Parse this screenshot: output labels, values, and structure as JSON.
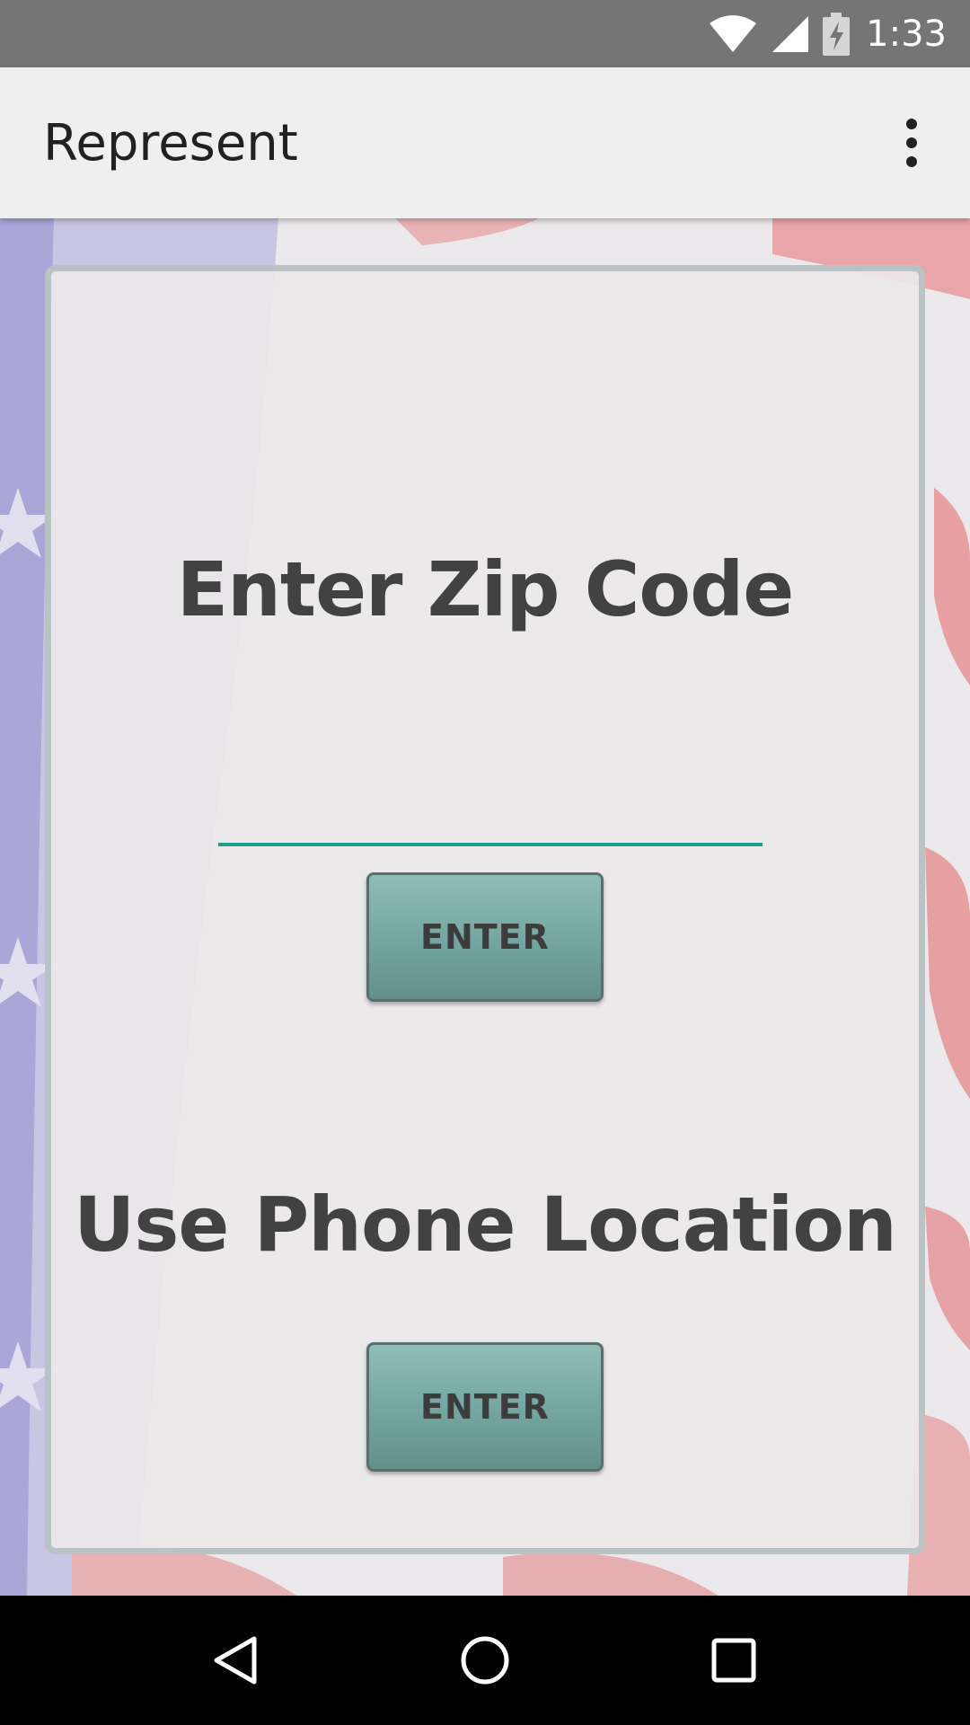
{
  "status_bar": {
    "time": "1:33",
    "icons": [
      "wifi-icon",
      "signal-icon",
      "battery-charging-icon"
    ]
  },
  "app_bar": {
    "title": "Represent",
    "overflow_icon": "more-vert-icon"
  },
  "zip_section": {
    "heading": "Enter Zip Code",
    "input_value": "",
    "button_label": "ENTER"
  },
  "location_section": {
    "heading": "Use Phone Location",
    "button_label": "ENTER"
  },
  "nav_bar": {
    "icons": [
      "back-icon",
      "home-icon",
      "recents-icon"
    ]
  },
  "colors": {
    "status_bar": "#757575",
    "app_bar": "#efefef",
    "accent_underline": "#1f9e8e",
    "button": "#76a7a1",
    "heading_text": "#424242",
    "card_border": "#b9c2c4"
  }
}
